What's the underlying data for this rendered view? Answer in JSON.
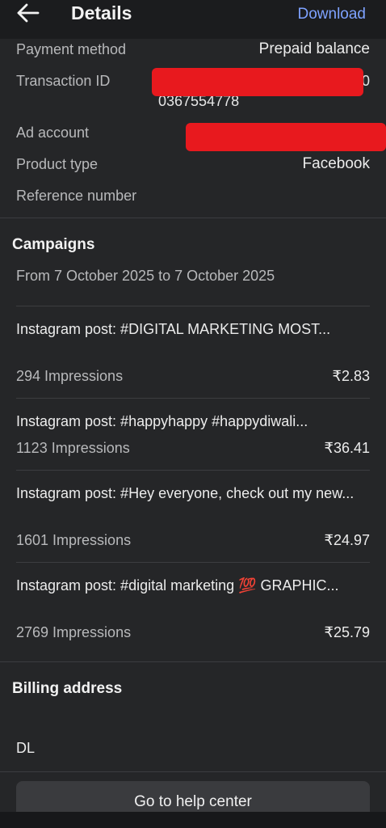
{
  "header": {
    "title": "Details",
    "download_label": "Download",
    "back_icon": "arrow-left-icon"
  },
  "details": {
    "payment_method": {
      "label": "Payment method",
      "value": "Prepaid balance"
    },
    "transaction_id": {
      "label": "Transaction ID",
      "value_tail_1": "0",
      "value_tail_2": "0367554778"
    },
    "ad_account": {
      "label": "Ad account"
    },
    "product_type": {
      "label": "Product type",
      "value": "Facebook"
    },
    "reference_number": {
      "label": "Reference number"
    }
  },
  "campaigns": {
    "title": "Campaigns",
    "date_range": "From 7 October 2025 to 7 October 2025",
    "items": [
      {
        "name": "Instagram post: #DIGITAL MARKETING MOST...",
        "impressions": "294 Impressions",
        "cost": "₹2.83"
      },
      {
        "name": "Instagram post: #happyhappy #happydiwali...",
        "impressions": "1123 Impressions",
        "cost": "₹36.41"
      },
      {
        "name": "Instagram post: #Hey everyone, check out my new...",
        "impressions": "1601 Impressions",
        "cost": "₹24.97"
      },
      {
        "name": "Instagram post: #digital marketing 💯 GRAPHIC...",
        "impressions": "2769 Impressions",
        "cost": "₹25.79"
      }
    ]
  },
  "billing": {
    "title": "Billing address",
    "line": "DL"
  },
  "footer": {
    "help_label": "Go to help center"
  },
  "colors": {
    "background": "#252628",
    "accent": "#7ea2ff",
    "redaction": "#e8191e"
  }
}
